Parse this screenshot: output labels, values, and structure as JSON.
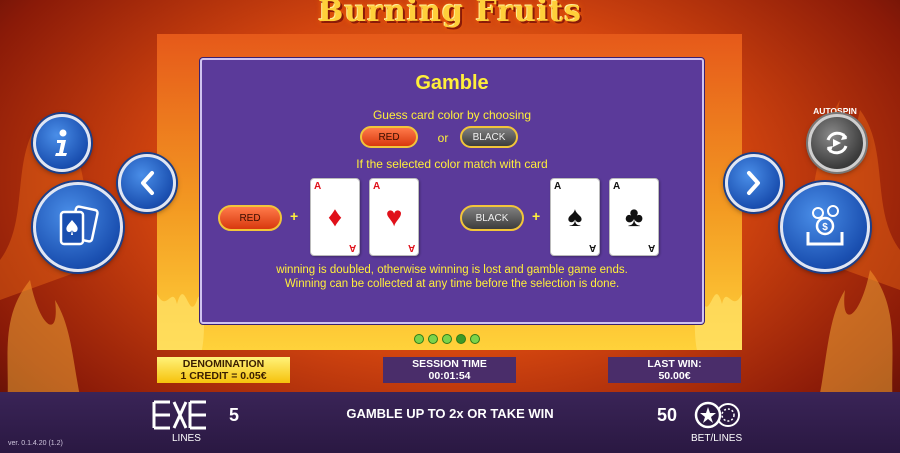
{
  "game": {
    "title": "Burning Fruits"
  },
  "help": {
    "title": "Gamble",
    "line1": "Guess card color by choosing",
    "or_text": "or",
    "line2": "If the selected color match with card",
    "red_label": "RED",
    "black_label": "BLACK",
    "plus": "+",
    "para1": "winning is doubled, otherwise winning is lost and gamble game ends.",
    "para2": "Winning can be collected at any time before the selection is done.",
    "cards": [
      {
        "rank": "A",
        "suit": "♦"
      },
      {
        "rank": "A",
        "suit": "♥"
      },
      {
        "rank": "A",
        "suit": "♠"
      },
      {
        "rank": "A",
        "suit": "♣"
      }
    ],
    "pager": {
      "total": 5,
      "current": 4
    }
  },
  "controls": {
    "autospin_label": "AUTOSPIN"
  },
  "info": {
    "denomination_label": "DENOMINATION",
    "denomination_value": "1 CREDIT = 0.05€",
    "session_label": "SESSION TIME",
    "session_value": "00:01:54",
    "lastwin_label": "LAST WIN:",
    "lastwin_value": "50.00€"
  },
  "bottom": {
    "lines_value": "5",
    "lines_label": "LINES",
    "message": "GAMBLE UP TO 2x OR TAKE WIN",
    "bet_value": "50",
    "bet_label": "BET/LINES",
    "version": "ver. 0.1.4.20 (1.2)"
  },
  "colors": {
    "accent_yellow": "#ffef3a",
    "panel_purple": "#5b3a9a",
    "button_blue": "#1a4fb0"
  }
}
